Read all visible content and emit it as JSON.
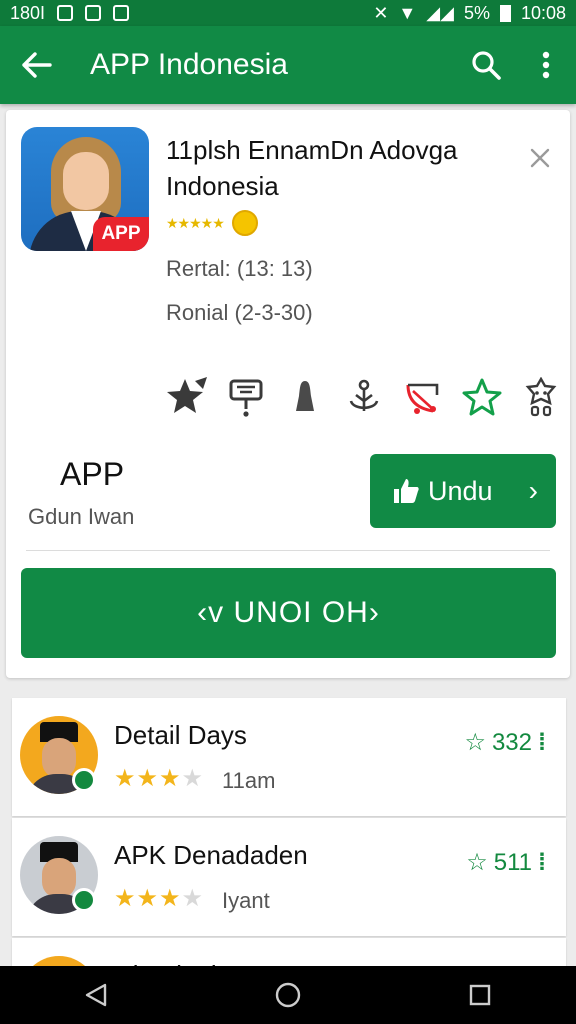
{
  "status_bar": {
    "left_text": "180I",
    "battery": "5%",
    "time": "10:08"
  },
  "app_bar": {
    "title": "APP Indonesia"
  },
  "detail": {
    "icon_badge": "APP",
    "name": "11plsh EnnamDn Adovga Indonesia",
    "mini_stars": "★★★★★",
    "meta_1": "Rertal: (13: 13)",
    "meta_2": "Ronial (2-3-30)",
    "features": [
      "star-burst-icon",
      "ticket-icon",
      "bell-icon",
      "anchor-icon",
      "bow-arrow-icon",
      "star-outline-icon",
      "robot-icon"
    ],
    "brand": "APP",
    "brand_sub": "Gdun Iwan",
    "undu_label": "Undu",
    "wide_button_label": "UNOI OH"
  },
  "list": [
    {
      "title": "Detail Days",
      "stars_on": "★★★",
      "stars_off": "★",
      "sub": "11am",
      "score": "332"
    },
    {
      "title": "APK Denadaden",
      "stars_on": "★★★",
      "stars_off": "★",
      "sub": "Iyant",
      "score": "511"
    },
    {
      "title": "Dlandr.I.k"
    }
  ],
  "colors": {
    "primary": "#118a45",
    "status": "#0e7a3a",
    "accent_red": "#e8232d",
    "star": "#f3b51b"
  }
}
